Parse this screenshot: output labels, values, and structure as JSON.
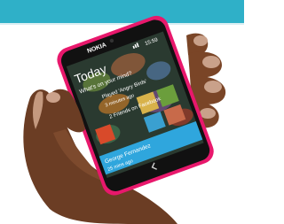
{
  "colors": {
    "banner": "#2fb0c8",
    "phone_body": "#e8186c",
    "skin": "#6b3d24",
    "notification_bar": "#2fa6dd"
  },
  "icons": [
    "nokia-logo-text",
    "signal-icon",
    "clock-icon",
    "back-icon",
    "camera-icon"
  ],
  "phone": {
    "brand": "NOKIA",
    "status_time": "15:59",
    "screen": {
      "title": "Today",
      "prompt": "What's on your mind?",
      "items": [
        {
          "text": "Played 'Angry Birds'"
        },
        {
          "text": "3 minutes ago"
        },
        {
          "text": "2 Friends on Facebook"
        }
      ],
      "notification": {
        "name": "George Fernandez",
        "text": "25 mins ago"
      }
    }
  }
}
